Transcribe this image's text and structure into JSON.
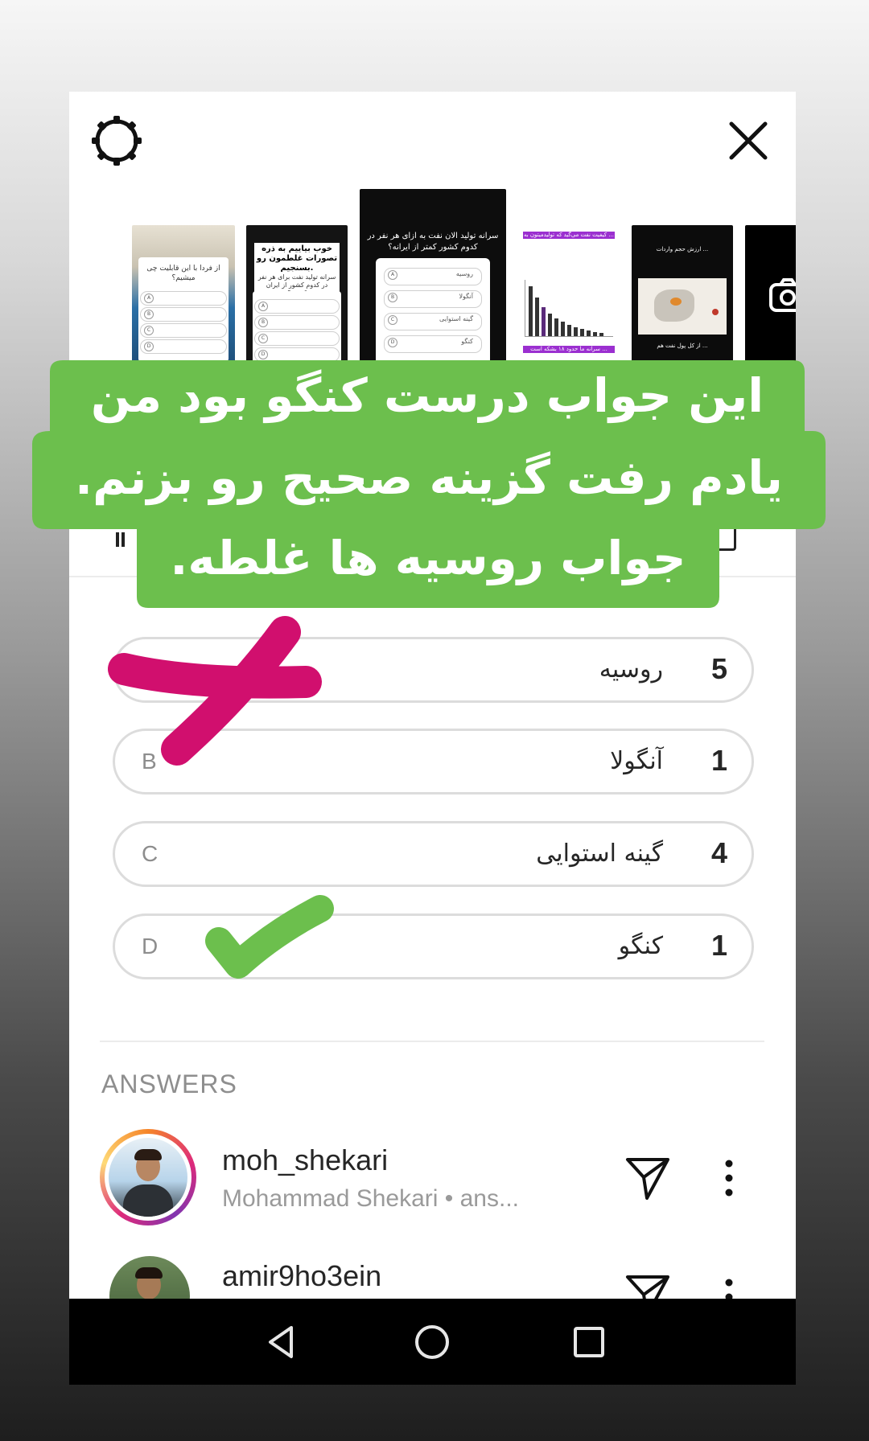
{
  "header": {
    "settings_icon": "gear-icon",
    "close_icon": "close-icon"
  },
  "thumbnails": [
    {
      "title": "از فردا با این قابلیت چی میشیم؟",
      "options": [
        "",
        "",
        "",
        ""
      ],
      "letters": [
        "A",
        "B",
        "C",
        "D"
      ]
    },
    {
      "title": "خوب بیاییم به ذره تصورات غلطمون رو بسنجیم.",
      "subtitle": "سرانه تولید نفت برای هر نفر در کدوم کشور از ایران کمتره؟",
      "letters": [
        "A",
        "B",
        "C",
        "D"
      ]
    },
    {
      "title": "سرانه تولید الان نفت به ازای هر نفر در کدوم کشور کمتر از ایرانه؟",
      "options": [
        "روسیه",
        "آنگولا",
        "گینه استوایی",
        "کنگو"
      ],
      "letters": [
        "A",
        "B",
        "C",
        "D"
      ]
    },
    {
      "title": "کیفیت نفت می‌گید که تولیدمیتون به ...",
      "caption": "سرانه ما حدود ۱۸ بشکه است ..."
    },
    {
      "title": "ارزش حجم واردات ...",
      "caption": "از کل پول نفت هم ..."
    },
    {
      "camera_icon": "camera-icon"
    }
  ],
  "results": {
    "options": [
      {
        "letter": "A",
        "label": "روسیه",
        "count": "5"
      },
      {
        "letter": "B",
        "label": "آنگولا",
        "count": "1"
      },
      {
        "letter": "C",
        "label": "گینه استوایی",
        "count": "4"
      },
      {
        "letter": "D",
        "label": "کنگو",
        "count": "1"
      }
    ]
  },
  "answers": {
    "title": "ANSWERS",
    "items": [
      {
        "username": "moh_shekari",
        "fullname": "Mohammad Shekari • ans..."
      },
      {
        "username": "amir9ho3ein",
        "fullname": ""
      }
    ]
  },
  "sticker": {
    "line1": "این جواب درست کنگو بود من",
    "line2": "یادم رفت گزینه صحیح رو بزنم.",
    "line3": "جواب روسیه ها غلطه.",
    "color": "#6cbf4d"
  },
  "marks": {
    "cross_color": "#d10f6e",
    "check_color": "#6cbf4d"
  },
  "navbar": {
    "back_icon": "back-triangle-icon",
    "home_icon": "home-circle-icon",
    "recents_icon": "recents-square-icon"
  }
}
